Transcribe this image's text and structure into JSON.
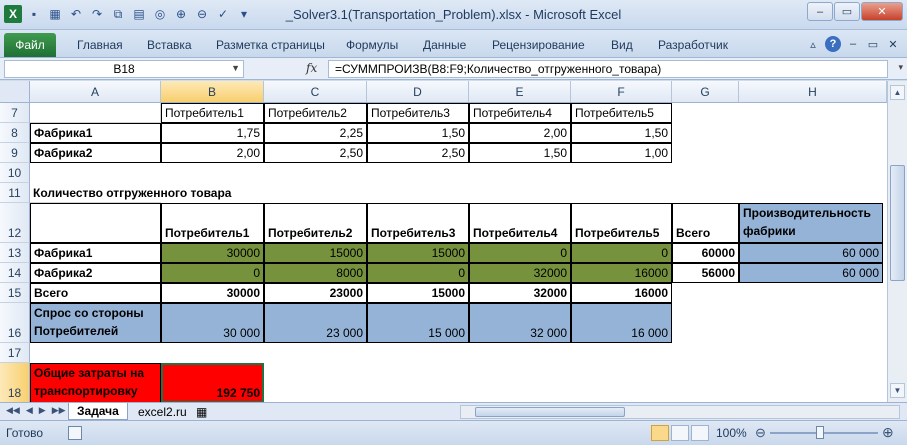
{
  "window": {
    "title": "_Solver3.1(Transportation_Problem).xlsx  -  Microsoft Excel",
    "minimize": "–",
    "maximize": "▭",
    "close": "✕"
  },
  "ribbon": {
    "file_tab": "Файл",
    "tabs": [
      "Главная",
      "Вставка",
      "Разметка страницы",
      "Формулы",
      "Данные",
      "Рецензирование",
      "Вид",
      "Разработчик"
    ]
  },
  "formula_bar": {
    "name_box": "B18",
    "fx": "fx",
    "formula": "=СУММПРОИЗВ(B8:F9;Количество_отгруженного_товара)"
  },
  "columns": [
    "A",
    "B",
    "C",
    "D",
    "E",
    "F",
    "G",
    "H"
  ],
  "selected_column": "B",
  "rows": [
    "7",
    "8",
    "9",
    "10",
    "11",
    "12",
    "13",
    "14",
    "15",
    "16",
    "17",
    "18"
  ],
  "selected_row": "18",
  "cells": {
    "r7": [
      "",
      "Потребитель1",
      "Потребитель2",
      "Потребитель3",
      "Потребитель4",
      "Потребитель5",
      "",
      ""
    ],
    "r8": [
      "Фабрика1",
      "1,75",
      "2,25",
      "1,50",
      "2,00",
      "1,50",
      "",
      ""
    ],
    "r9": [
      "Фабрика2",
      "2,00",
      "2,50",
      "2,50",
      "1,50",
      "1,00",
      "",
      ""
    ],
    "r11": [
      "Количество отгруженного товара"
    ],
    "r12": [
      "",
      "Потребитель1",
      "Потребитель2",
      "Потребитель3",
      "Потребитель4",
      "Потребитель5",
      "Всего",
      "Производительность фабрики"
    ],
    "r13": [
      "Фабрика1",
      "30000",
      "15000",
      "15000",
      "0",
      "0",
      "60000",
      "60 000"
    ],
    "r14": [
      "Фабрика2",
      "0",
      "8000",
      "0",
      "32000",
      "16000",
      "56000",
      "60 000"
    ],
    "r15": [
      "Всего",
      "30000",
      "23000",
      "15000",
      "32000",
      "16000"
    ],
    "r16": [
      "Спрос со стороны Потребителей",
      "30 000",
      "23 000",
      "15 000",
      "32 000",
      "16 000"
    ],
    "r18": [
      "Общие затраты на транспортировку",
      "192 750"
    ]
  },
  "sheet_tabs": [
    "Задача",
    "excel2.ru"
  ],
  "active_sheet": "Задача",
  "status": {
    "ready": "Готово",
    "zoom": "100%"
  },
  "colors": {
    "green": "#76923c",
    "blue": "#95b3d7",
    "red": "#ff0000"
  }
}
